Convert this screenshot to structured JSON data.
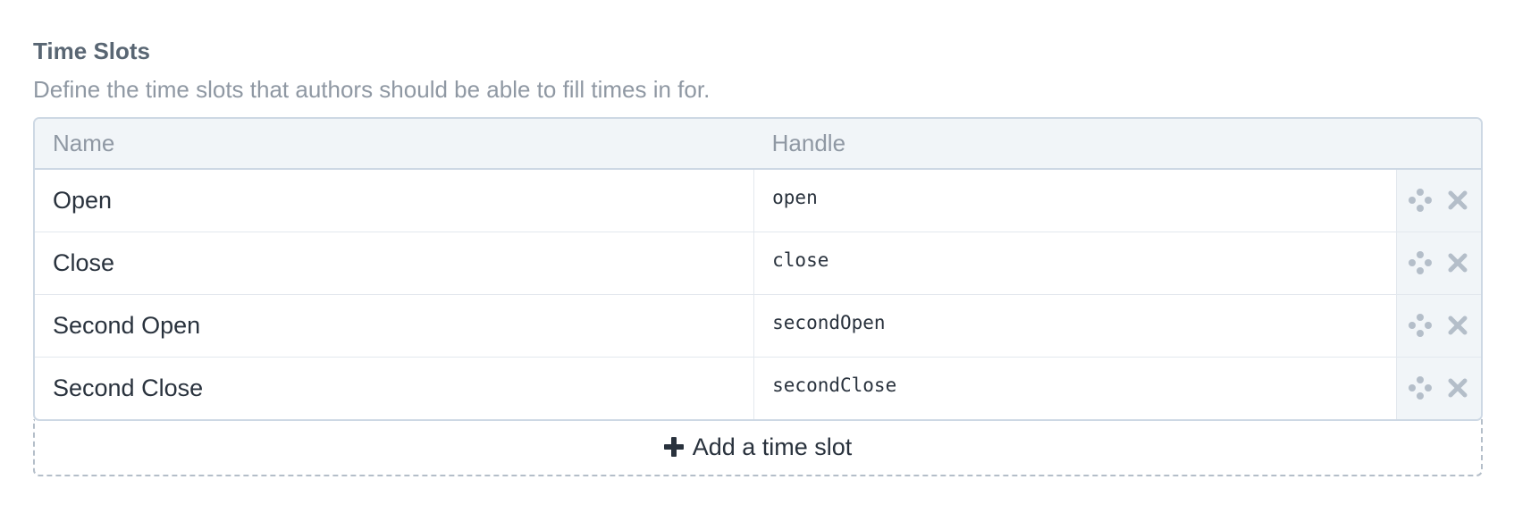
{
  "field": {
    "heading": "Time Slots",
    "instructions": "Define the time slots that authors should be able to fill times in for."
  },
  "table": {
    "columns": [
      "Name",
      "Handle"
    ],
    "rows": [
      {
        "name": "Open",
        "handle": "open"
      },
      {
        "name": "Close",
        "handle": "close"
      },
      {
        "name": "Second Open",
        "handle": "secondOpen"
      },
      {
        "name": "Second Close",
        "handle": "secondClose"
      }
    ],
    "row_actions": [
      "move-icon",
      "delete-icon"
    ]
  },
  "add_button": {
    "icon": "plus-icon",
    "label": "Add a time slot"
  },
  "colors": {
    "heading": "#596673",
    "instructions": "#8f98a3",
    "header_bg": "#f1f5f8",
    "border": "#cdd8e4",
    "icon": "#b4bec9",
    "text": "#29323d"
  }
}
